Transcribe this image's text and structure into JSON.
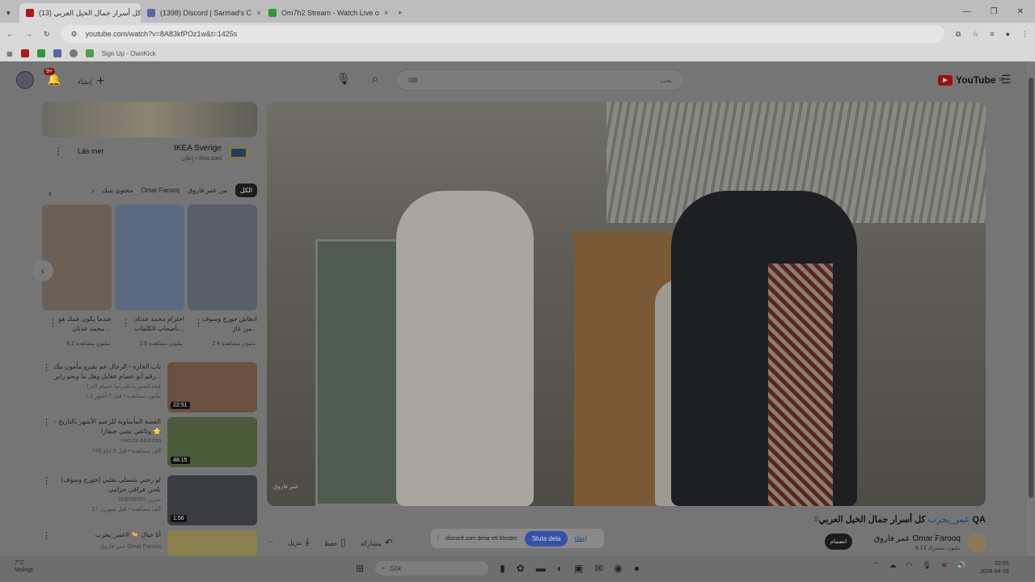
{
  "browser": {
    "tabs": [
      {
        "title": "(13) كل أسرار جمال الخيل العربي",
        "color": "#b01818"
      },
      {
        "title": "(1398) Discord | Sarmad's C",
        "color": "#5865a8"
      },
      {
        "title": "Om7h2 Stream - Watch Live o",
        "color": "#2f9a2f"
      }
    ],
    "new_tab": "+",
    "url": "youtube.com/watch?v=8A83kfPOz1w&t=1425s",
    "bookmarks": [
      "Sign Up - OwnKick"
    ]
  },
  "yt": {
    "notif_count": "9+",
    "create_label": "إنشاء",
    "search_placeholder": "بحث",
    "logo": "YouTube",
    "logo_sup": "SE"
  },
  "ad": {
    "title": "IKEA Sverige",
    "sub": "إعلان • ikea.com",
    "more": "Läs mer"
  },
  "chips": [
    "الكل",
    "من عمر فاروق",
    "Omar Farooq",
    "محتوى ينيك",
    "ذ"
  ],
  "shorts": [
    {
      "title": "ادهاش جورج وسوف من عاز...",
      "views": "2.4 مليون مشاهدة"
    },
    {
      "title": "احترام محمد عدنان بأصحاب الكلمات...",
      "views": "1.9 مليون مشاهدة"
    },
    {
      "title": "عندما يكون عمك هو محمد عدنان ...",
      "views": "8.2 مليون مشاهدة"
    }
  ],
  "recs": [
    {
      "title": "باب الحارة - الرجال عم يفيرو مأمون بيك رقم أبو عصام عقابل وهل ما وبجو زاير...",
      "chan": "قناة السورية للدراما خسام الدرا",
      "meta": "1.2 مليون مشاهدة • قبل 7 أشهر",
      "dur": "22:51",
      "color": "#6a5040"
    },
    {
      "title": "القصة المأساوية للزعيم الأشهر بالتاريخ - وثائقي تشي جيفارا ⭐",
      "chan": "Hamza Abdrzaq",
      "meta": "749 ألف مشاهدة • قبل 3 أيام",
      "dur": "48:15",
      "color": "#4a5a3a"
    },
    {
      "title": "لو رحتي بتنسلي بقلبي (جورج وسوف) بلحن عراقي حزامي",
      "chan": "SHEREEN شرين",
      "meta": "17 ألف مشاهدة • قبل شهرين",
      "dur": "1:56",
      "color": "#3a3c40"
    },
    {
      "title": "أنا خيال 🐎 #عمر_يجرب",
      "chan": "عمر فاروق Omar Farooq",
      "meta": "",
      "dur": "",
      "color": "#8a8050"
    }
  ],
  "video": {
    "title": "كل أسرار جمال الخيل العربي QA",
    "hashtag": "#عمر_يجرب",
    "channel": "عمر فاروق Omar Farooq",
    "subs": "8.13 مليون مشترك",
    "join": "انضمام",
    "watermark": "عمر فاروق"
  },
  "actions": {
    "save": "حفظ",
    "download": "تنزيل",
    "share": "مشاركة"
  },
  "popup": {
    "text": "discord.com delar ett fönster.",
    "stop": "Sluta dela",
    "hide": "إخفاء"
  },
  "taskbar": {
    "temp": "7°C",
    "weather": "Molnigt",
    "search": "Sök",
    "time": "02:55",
    "date": "2026-04-18"
  }
}
